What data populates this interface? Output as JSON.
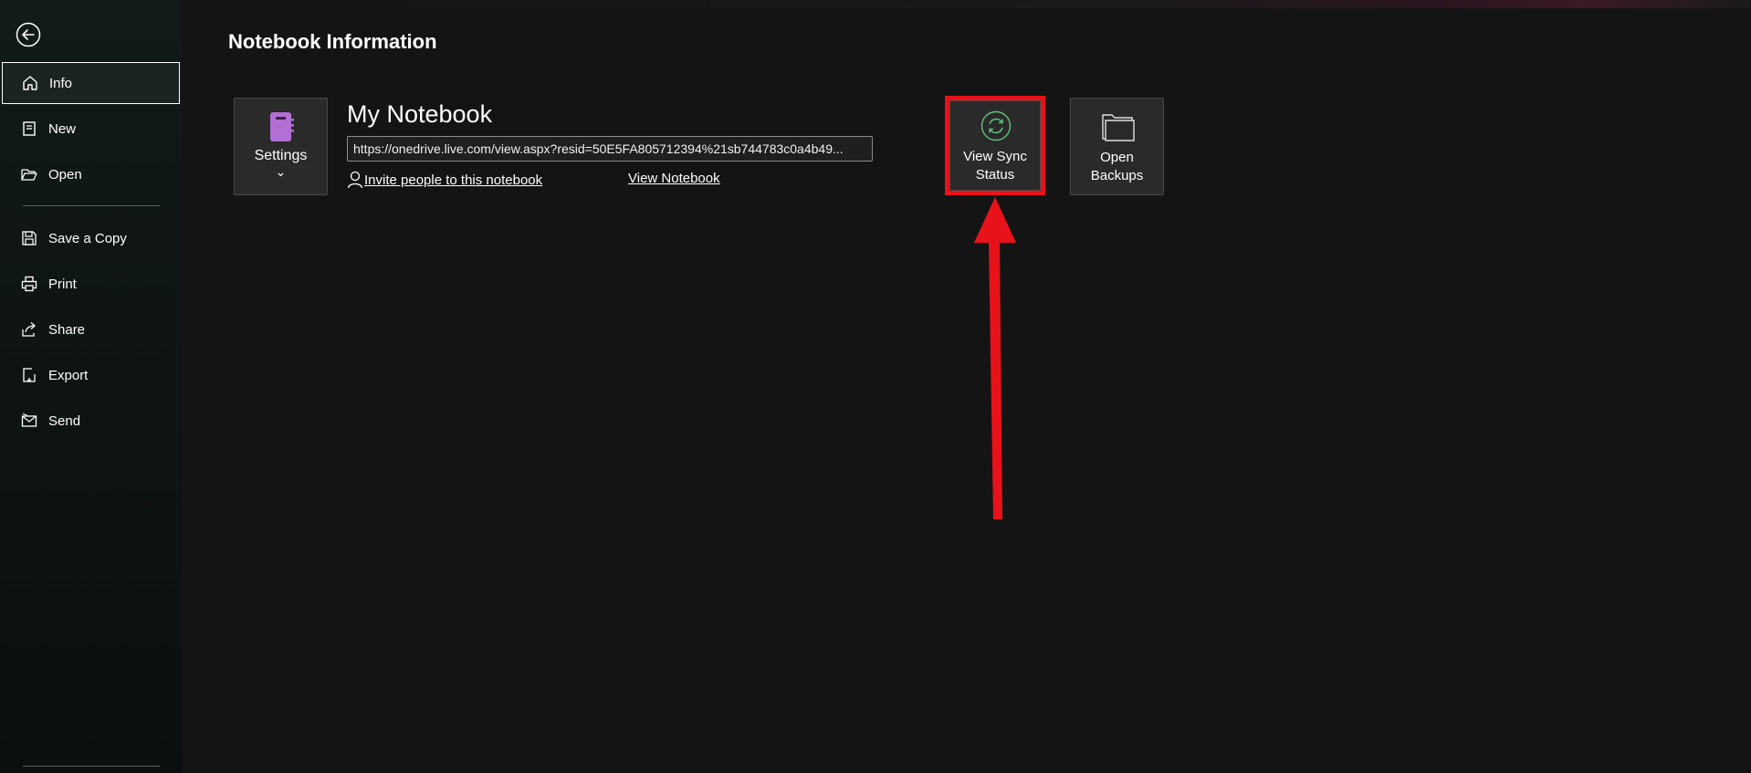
{
  "sidebar": {
    "back_label": "Back",
    "items": [
      {
        "label": "Info",
        "icon": "home-icon"
      },
      {
        "label": "New",
        "icon": "new-page-icon"
      },
      {
        "label": "Open",
        "icon": "folder-open-icon"
      },
      {
        "label": "Save a Copy",
        "icon": "save-copy-icon"
      },
      {
        "label": "Print",
        "icon": "printer-icon"
      },
      {
        "label": "Share",
        "icon": "share-icon"
      },
      {
        "label": "Export",
        "icon": "export-icon"
      },
      {
        "label": "Send",
        "icon": "send-icon"
      }
    ]
  },
  "main": {
    "title": "Notebook Information",
    "notebook": {
      "name": "My Notebook",
      "url": "https://onedrive.live.com/view.aspx?resid=50E5FA805712394%21sb744783c0a4b49...",
      "invite_link": "Invite people to this notebook",
      "view_link": "View Notebook"
    },
    "settings_tile": {
      "label": "Settings",
      "chevron": "⌄"
    },
    "sync_tile": {
      "line1": "View Sync",
      "line2": "Status"
    },
    "backups_tile": {
      "line1": "Open",
      "line2": "Backups"
    }
  },
  "colors": {
    "accent_purple": "#b26fd4",
    "sync_green": "#5fc07a",
    "annotation_red": "#e8121a"
  }
}
